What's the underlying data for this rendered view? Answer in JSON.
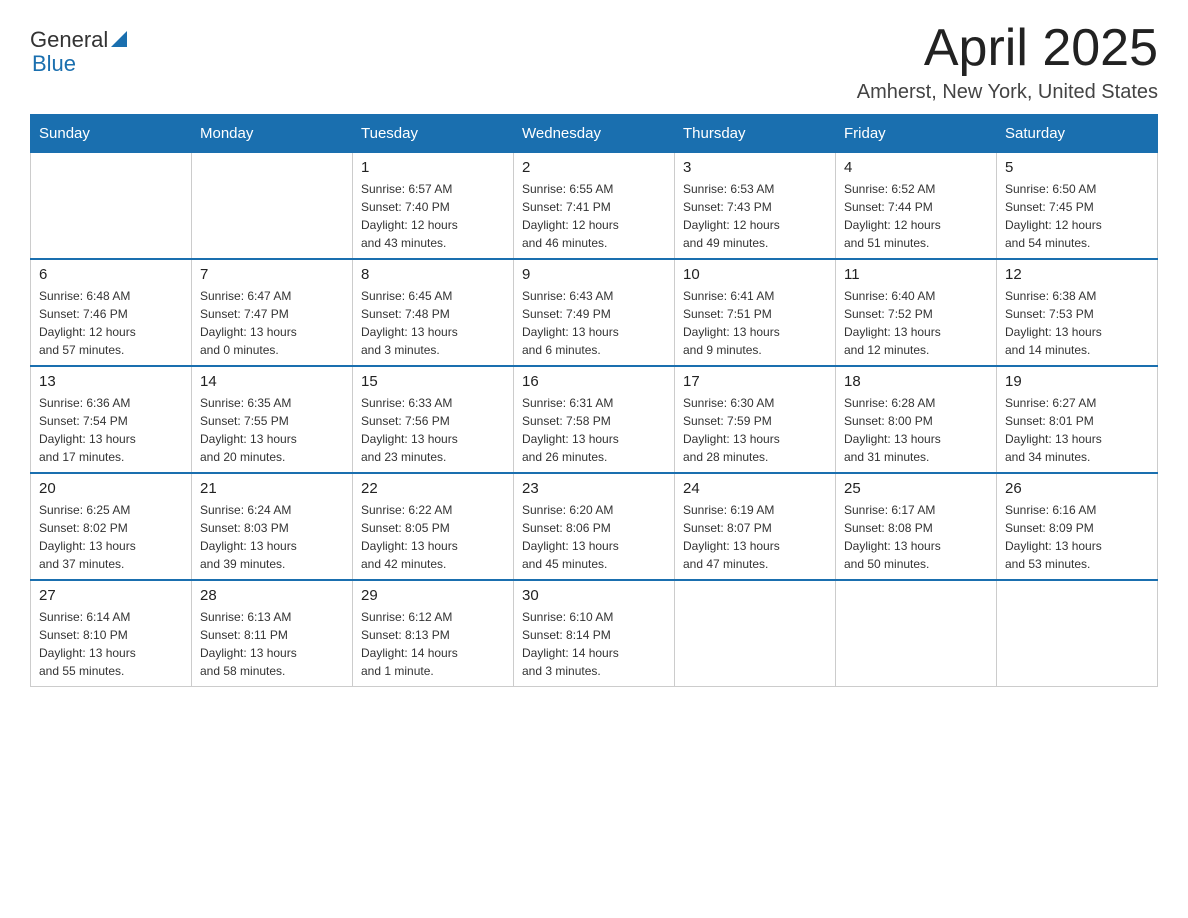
{
  "logo": {
    "text_general": "General",
    "text_blue": "Blue",
    "triangle_label": "logo-triangle"
  },
  "header": {
    "title": "April 2025",
    "subtitle": "Amherst, New York, United States"
  },
  "weekdays": [
    "Sunday",
    "Monday",
    "Tuesday",
    "Wednesday",
    "Thursday",
    "Friday",
    "Saturday"
  ],
  "weeks": [
    [
      {
        "day": "",
        "info": ""
      },
      {
        "day": "",
        "info": ""
      },
      {
        "day": "1",
        "info": "Sunrise: 6:57 AM\nSunset: 7:40 PM\nDaylight: 12 hours\nand 43 minutes."
      },
      {
        "day": "2",
        "info": "Sunrise: 6:55 AM\nSunset: 7:41 PM\nDaylight: 12 hours\nand 46 minutes."
      },
      {
        "day": "3",
        "info": "Sunrise: 6:53 AM\nSunset: 7:43 PM\nDaylight: 12 hours\nand 49 minutes."
      },
      {
        "day": "4",
        "info": "Sunrise: 6:52 AM\nSunset: 7:44 PM\nDaylight: 12 hours\nand 51 minutes."
      },
      {
        "day": "5",
        "info": "Sunrise: 6:50 AM\nSunset: 7:45 PM\nDaylight: 12 hours\nand 54 minutes."
      }
    ],
    [
      {
        "day": "6",
        "info": "Sunrise: 6:48 AM\nSunset: 7:46 PM\nDaylight: 12 hours\nand 57 minutes."
      },
      {
        "day": "7",
        "info": "Sunrise: 6:47 AM\nSunset: 7:47 PM\nDaylight: 13 hours\nand 0 minutes."
      },
      {
        "day": "8",
        "info": "Sunrise: 6:45 AM\nSunset: 7:48 PM\nDaylight: 13 hours\nand 3 minutes."
      },
      {
        "day": "9",
        "info": "Sunrise: 6:43 AM\nSunset: 7:49 PM\nDaylight: 13 hours\nand 6 minutes."
      },
      {
        "day": "10",
        "info": "Sunrise: 6:41 AM\nSunset: 7:51 PM\nDaylight: 13 hours\nand 9 minutes."
      },
      {
        "day": "11",
        "info": "Sunrise: 6:40 AM\nSunset: 7:52 PM\nDaylight: 13 hours\nand 12 minutes."
      },
      {
        "day": "12",
        "info": "Sunrise: 6:38 AM\nSunset: 7:53 PM\nDaylight: 13 hours\nand 14 minutes."
      }
    ],
    [
      {
        "day": "13",
        "info": "Sunrise: 6:36 AM\nSunset: 7:54 PM\nDaylight: 13 hours\nand 17 minutes."
      },
      {
        "day": "14",
        "info": "Sunrise: 6:35 AM\nSunset: 7:55 PM\nDaylight: 13 hours\nand 20 minutes."
      },
      {
        "day": "15",
        "info": "Sunrise: 6:33 AM\nSunset: 7:56 PM\nDaylight: 13 hours\nand 23 minutes."
      },
      {
        "day": "16",
        "info": "Sunrise: 6:31 AM\nSunset: 7:58 PM\nDaylight: 13 hours\nand 26 minutes."
      },
      {
        "day": "17",
        "info": "Sunrise: 6:30 AM\nSunset: 7:59 PM\nDaylight: 13 hours\nand 28 minutes."
      },
      {
        "day": "18",
        "info": "Sunrise: 6:28 AM\nSunset: 8:00 PM\nDaylight: 13 hours\nand 31 minutes."
      },
      {
        "day": "19",
        "info": "Sunrise: 6:27 AM\nSunset: 8:01 PM\nDaylight: 13 hours\nand 34 minutes."
      }
    ],
    [
      {
        "day": "20",
        "info": "Sunrise: 6:25 AM\nSunset: 8:02 PM\nDaylight: 13 hours\nand 37 minutes."
      },
      {
        "day": "21",
        "info": "Sunrise: 6:24 AM\nSunset: 8:03 PM\nDaylight: 13 hours\nand 39 minutes."
      },
      {
        "day": "22",
        "info": "Sunrise: 6:22 AM\nSunset: 8:05 PM\nDaylight: 13 hours\nand 42 minutes."
      },
      {
        "day": "23",
        "info": "Sunrise: 6:20 AM\nSunset: 8:06 PM\nDaylight: 13 hours\nand 45 minutes."
      },
      {
        "day": "24",
        "info": "Sunrise: 6:19 AM\nSunset: 8:07 PM\nDaylight: 13 hours\nand 47 minutes."
      },
      {
        "day": "25",
        "info": "Sunrise: 6:17 AM\nSunset: 8:08 PM\nDaylight: 13 hours\nand 50 minutes."
      },
      {
        "day": "26",
        "info": "Sunrise: 6:16 AM\nSunset: 8:09 PM\nDaylight: 13 hours\nand 53 minutes."
      }
    ],
    [
      {
        "day": "27",
        "info": "Sunrise: 6:14 AM\nSunset: 8:10 PM\nDaylight: 13 hours\nand 55 minutes."
      },
      {
        "day": "28",
        "info": "Sunrise: 6:13 AM\nSunset: 8:11 PM\nDaylight: 13 hours\nand 58 minutes."
      },
      {
        "day": "29",
        "info": "Sunrise: 6:12 AM\nSunset: 8:13 PM\nDaylight: 14 hours\nand 1 minute."
      },
      {
        "day": "30",
        "info": "Sunrise: 6:10 AM\nSunset: 8:14 PM\nDaylight: 14 hours\nand 3 minutes."
      },
      {
        "day": "",
        "info": ""
      },
      {
        "day": "",
        "info": ""
      },
      {
        "day": "",
        "info": ""
      }
    ]
  ]
}
